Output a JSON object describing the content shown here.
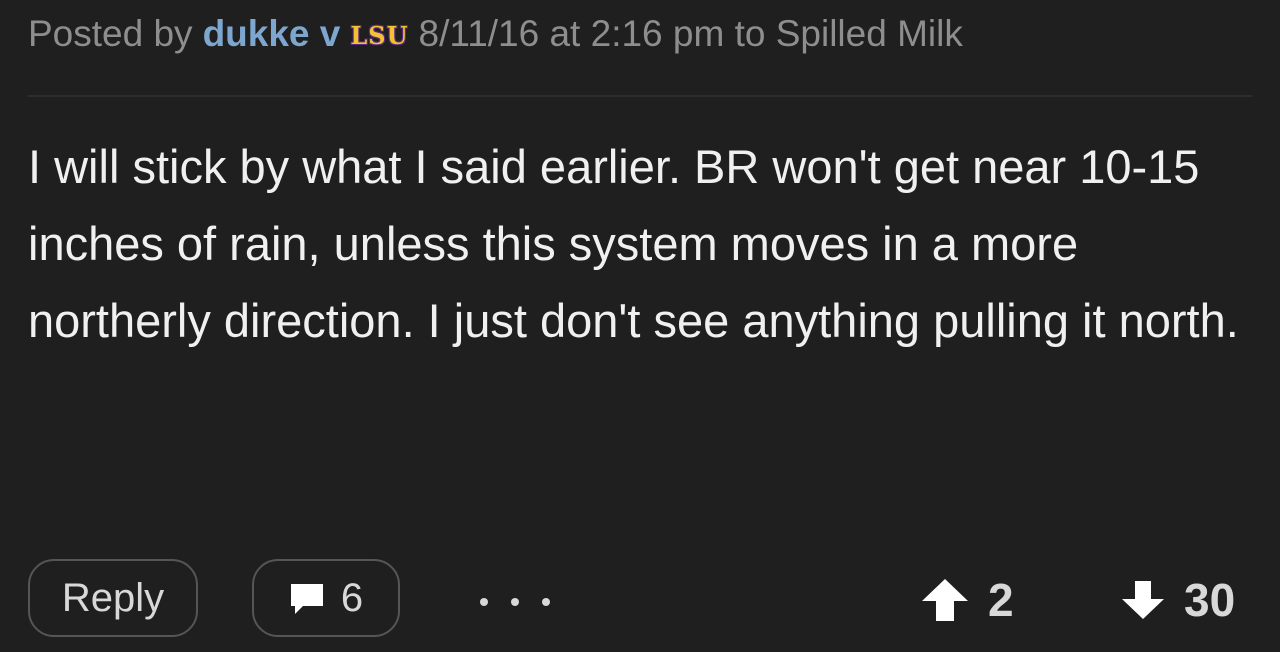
{
  "post": {
    "posted_by_label": "Posted by",
    "author": "dukke v",
    "team_logo_text": "LSU",
    "meta": "8/11/16 at 2:16 pm to Spilled Milk",
    "body": "I will stick by what I said earlier. BR won't get near 10-15 inches of rain, unless this system moves in a more northerly direction. I just don't see anything pulling it north."
  },
  "actions": {
    "reply_label": "Reply",
    "comment_count": "6",
    "upvotes": "2",
    "downvotes": "30"
  },
  "icons": {
    "comment": "comment-icon",
    "more": "more-icon",
    "upvote": "arrow-up-icon",
    "downvote": "arrow-down-icon",
    "team_logo": "lsu-logo"
  },
  "colors": {
    "background": "#1f1f1f",
    "author": "#7ea7cf",
    "meta_text": "#8e8e8e",
    "body_text": "#f0f0f0",
    "logo_gold": "#f2c230",
    "logo_purple": "#5b2a82"
  }
}
